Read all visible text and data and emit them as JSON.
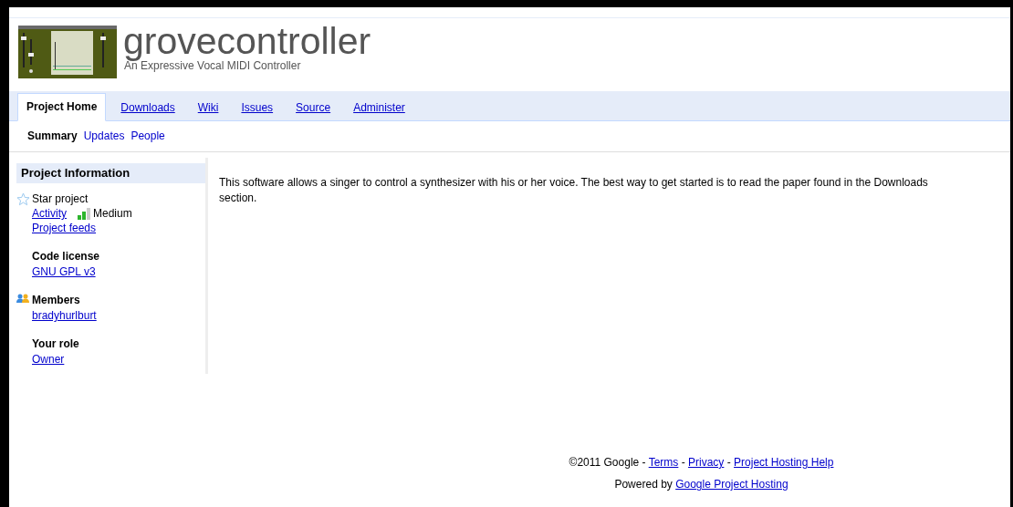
{
  "project": {
    "name": "grovecontroller",
    "summary": "An Expressive Vocal MIDI Controller"
  },
  "tabs": [
    {
      "label": "Project Home",
      "selected": true
    },
    {
      "label": "Downloads",
      "selected": false
    },
    {
      "label": "Wiki",
      "selected": false
    },
    {
      "label": "Issues",
      "selected": false
    },
    {
      "label": "Source",
      "selected": false
    },
    {
      "label": "Administer",
      "selected": false
    }
  ],
  "subtabs": [
    {
      "label": "Summary",
      "selected": true
    },
    {
      "label": "Updates",
      "selected": false
    },
    {
      "label": "People",
      "selected": false
    }
  ],
  "sidebar": {
    "heading": "Project Information",
    "star": {
      "label": "Star project",
      "starred": false
    },
    "activity": {
      "label": "Activity",
      "level": 0.67,
      "reading": "Medium"
    },
    "feeds": "Project feeds",
    "sections": [
      {
        "kind": "plain",
        "title": "Code license",
        "links": [
          "GNU GPL v3"
        ]
      },
      {
        "kind": "members",
        "title": "Members",
        "links": [
          "bradyhurlburt"
        ]
      },
      {
        "kind": "plain",
        "title": "Your role",
        "links": [
          "Owner"
        ]
      }
    ]
  },
  "description": "This software allows a singer to control a synthesizer with his or her voice. The best way to get started is to read the paper found in the Downloads section.",
  "footer": {
    "lines": [
      {
        "text": "©2011 Google",
        "separator": "-",
        "links": [
          "Terms",
          "Privacy",
          "Project Hosting Help"
        ]
      },
      {
        "text": "Powered by",
        "links": [
          "Google Project Hosting"
        ]
      }
    ]
  }
}
